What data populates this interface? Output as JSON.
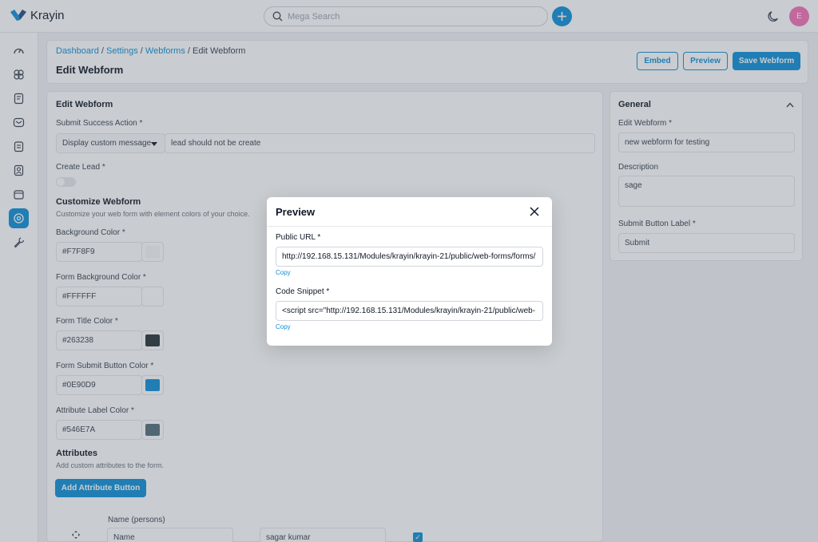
{
  "app": {
    "name": "Krayin",
    "user_initial": "E"
  },
  "search": {
    "placeholder": "Mega Search"
  },
  "sidebar": {
    "items": [
      {
        "name": "dashboard-icon"
      },
      {
        "name": "leads-icon"
      },
      {
        "name": "quotes-icon"
      },
      {
        "name": "mail-icon"
      },
      {
        "name": "activities-icon"
      },
      {
        "name": "contacts-icon"
      },
      {
        "name": "products-icon"
      },
      {
        "name": "settings-icon"
      },
      {
        "name": "configuration-icon"
      }
    ]
  },
  "breadcrumb": {
    "dashboard": "Dashboard",
    "settings": "Settings",
    "webforms": "Webforms",
    "current": "Edit Webform",
    "sep": " / "
  },
  "header": {
    "title": "Edit Webform",
    "embed": "Embed",
    "preview": "Preview",
    "save": "Save Webform"
  },
  "form": {
    "title": "Edit Webform",
    "submit_action_label": "Submit Success Action *",
    "submit_action_select": "Display custom message",
    "submit_action_value": "lead should not be create",
    "create_lead_label": "Create Lead *",
    "customize_title": "Customize Webform",
    "customize_desc": "Customize your web form with element colors of your choice.",
    "colors": [
      {
        "label": "Background Color *",
        "value": "#F7F8F9",
        "swatch": "#F7F8F9"
      },
      {
        "label": "Form Background Color *",
        "value": "#FFFFFF",
        "swatch": "#FFFFFF"
      },
      {
        "label": "Form Title Color *",
        "value": "#263238",
        "swatch": "#263238"
      },
      {
        "label": "Form Submit Button Color *",
        "value": "#0E90D9",
        "swatch": "#0E90D9"
      },
      {
        "label": "Attribute Label Color *",
        "value": "#546E7A",
        "swatch": "#546E7A"
      }
    ],
    "attributes_title": "Attributes",
    "attributes_desc": "Add custom attributes to the form.",
    "add_attribute": "Add Attribute Button",
    "attr_row": {
      "header": "Name (persons)",
      "name": "Name",
      "placeholder_value": "sagar kumar"
    }
  },
  "general": {
    "title": "General",
    "webform_label": "Edit Webform *",
    "webform_value": "new webform for testing",
    "description_label": "Description",
    "description_value": "sage",
    "submit_label": "Submit Button Label *",
    "submit_value": "Submit"
  },
  "modal": {
    "title": "Preview",
    "public_url_label": "Public URL *",
    "public_url": "http://192.168.15.131/Modules/krayin/krayin-21/public/web-forms/forms/",
    "copy": "Copy",
    "code_label": "Code Snippet *",
    "code_snippet": "<script src=\"http://192.168.15.131/Modules/krayin/krayin-21/public/web-"
  },
  "colors": {
    "accent": "#0E90D9"
  }
}
